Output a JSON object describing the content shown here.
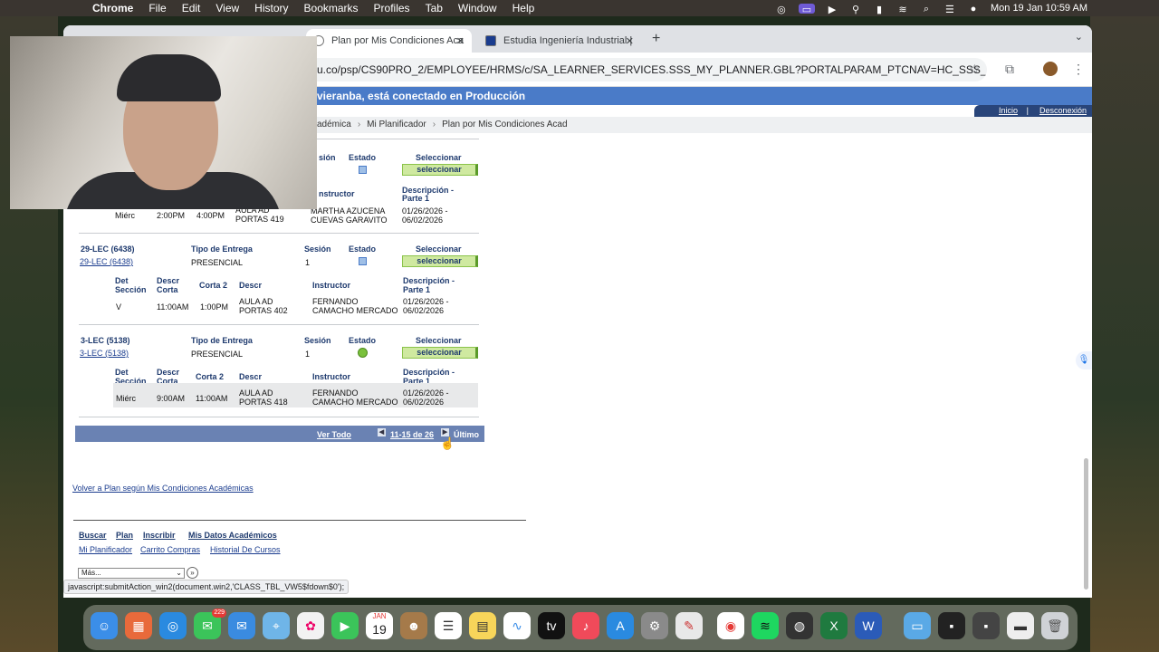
{
  "menubar": {
    "app": "Chrome",
    "items": [
      "File",
      "Edit",
      "View",
      "History",
      "Bookmarks",
      "Profiles",
      "Tab",
      "Window",
      "Help"
    ],
    "clock": "Mon 19 Jan  10:59 AM"
  },
  "browser": {
    "tabs": [
      {
        "label": "Plan por Mis Condiciones Aca"
      },
      {
        "label": "Estudia Ingeniería Industrial |"
      }
    ],
    "url": "u.co/psp/CS90PRO_2/EMPLOYEE/HRMS/c/SA_LEARNER_SERVICES.SSS_MY_PLANNER.GBL?PORTALPARAM_PTCNAV=HC_SSS_MY..."
  },
  "page": {
    "banner": "vieranba, está conectado en Producción",
    "nav": {
      "inicio": "Inicio",
      "desconexion": "Desconexión"
    },
    "breadcrumb": [
      "adémica",
      "Mi Planificador",
      "Plan por Mis Condiciones Acad"
    ],
    "top_partial": {
      "hdr_sesion": "sión",
      "hdr_estado": "Estado",
      "hdr_seleccionar": "Seleccionar",
      "btn": "seleccionar",
      "hdr_instructor": "nstructor",
      "hdr_desc1": "Descripción -",
      "hdr_desc2": "Parte 1",
      "row": {
        "dia": "Miérc",
        "inicio": "2:00PM",
        "fin": "4:00PM",
        "aula": "AULA AD PORTAS 419",
        "instructor": "MARTHA AZUCENA CUEVAS GARAVITO",
        "fechas": "01/26/2026 - 06/02/2026"
      }
    },
    "sections": [
      {
        "title": "29-LEC (6438)",
        "link": "29-LEC (6438)",
        "hdr_tipo": "Tipo de Entrega",
        "hdr_sesion": "Sesión",
        "hdr_estado": "Estado",
        "hdr_seleccionar": "Seleccionar",
        "tipo": "PRESENCIAL",
        "sesion": "1",
        "estado": "open",
        "btn": "seleccionar",
        "sub_hdrs": {
          "det": "Det Sección",
          "desc": "Descr Corta",
          "corta": "Corta 2",
          "descr": "Descr",
          "instructor": "Instructor",
          "desc1": "Descripción - Parte 1"
        },
        "row": {
          "dia": "V",
          "inicio": "11:00AM",
          "fin": "1:00PM",
          "aula": "AULA AD PORTAS 402",
          "instructor": "FERNANDO  CAMACHO MERCADO",
          "fechas": "01/26/2026 - 06/02/2026"
        }
      },
      {
        "title": "3-LEC (5138)",
        "link": "3-LEC (5138)",
        "hdr_tipo": "Tipo de Entrega",
        "hdr_sesion": "Sesión",
        "hdr_estado": "Estado",
        "hdr_seleccionar": "Seleccionar",
        "tipo": "PRESENCIAL",
        "sesion": "1",
        "estado": "green",
        "btn": "seleccionar",
        "sub_hdrs": {
          "det": "Det Sección",
          "desc": "Descr Corta",
          "corta": "Corta 2",
          "descr": "Descr",
          "instructor": "Instructor",
          "desc1": "Descripción - Parte 1"
        },
        "row": {
          "dia": "Miérc",
          "inicio": "9:00AM",
          "fin": "11:00AM",
          "aula": "AULA AD PORTAS 418",
          "instructor": "FERNANDO  CAMACHO MERCADO",
          "fechas": "01/26/2026 - 06/02/2026"
        }
      }
    ],
    "pager": {
      "ver_todo": "Ver Todo",
      "range": "11-15 de 26",
      "ultimo": "Último"
    },
    "volver": "Volver a Plan según Mis Condiciones Académicas",
    "bottom_nav": {
      "primary": [
        "Buscar",
        "Plan",
        "Inscribir",
        "Mis Datos Académicos"
      ],
      "secondary": [
        "Mi Planificador",
        "Carrito Compras",
        "Historial De Cursos"
      ]
    },
    "more_select": "Más...",
    "status_url": "javascript:submitAction_win2(document.win2,'CLASS_TBL_VW5$fdown$0');"
  },
  "dock": {
    "messages_badge": "229",
    "calendar_month": "JAN",
    "calendar_day": "19"
  },
  "colors": {
    "banner": "#4a7bc8",
    "header_text": "#1e3a6e",
    "select_button": "#cfe9a0",
    "pager": "#6a82b3"
  }
}
